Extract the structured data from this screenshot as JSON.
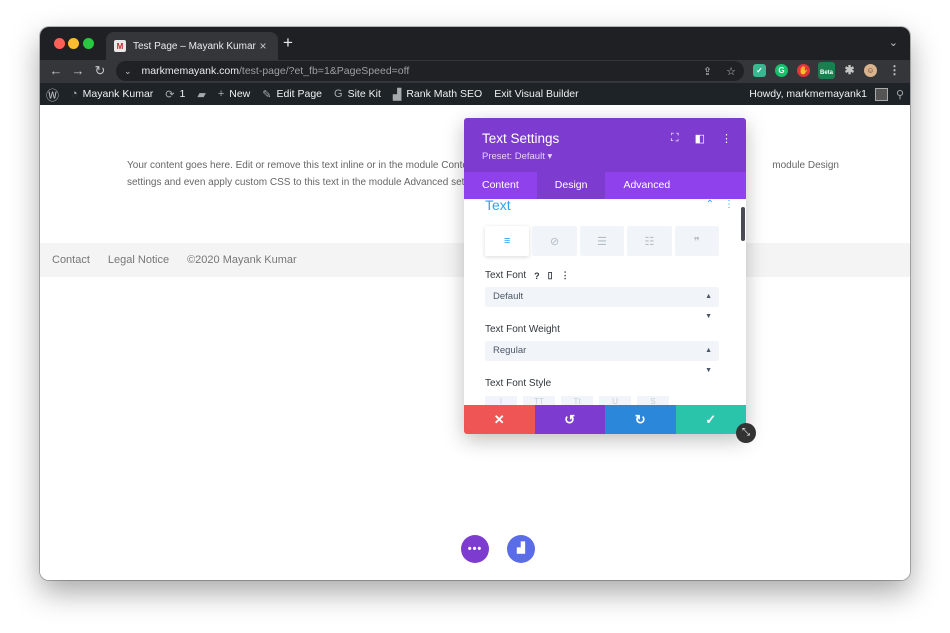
{
  "browser": {
    "tab_title": "Test Page – Mayank Kumar",
    "tab_close": "×",
    "new_tab": "+",
    "tab_menu": "⌄",
    "url_host": "markmemayank.com",
    "url_path": "/test-page/?et_fb=1&PageSpeed=off",
    "nav_back": "←",
    "nav_forward": "→",
    "nav_reload": "↻",
    "extension_beta_badge": "Beta"
  },
  "adminbar": {
    "site_name": "Mayank Kumar",
    "updates_count": "1",
    "new_label": "New",
    "edit_page_label": "Edit Page",
    "site_kit_label": "Site Kit",
    "rank_math_label": "Rank Math SEO",
    "exit_builder_label": "Exit Visual Builder",
    "howdy_label": "Howdy, markmemayank1"
  },
  "page": {
    "body_line1": "Your content goes here. Edit or remove this text inline or in the module Conte",
    "body_line1_right": "module Design",
    "body_line2": "settings and even apply custom CSS to this text in the module Advanced setti",
    "footer_contact": "Contact",
    "footer_legal": "Legal Notice",
    "footer_copyright": "©2020 Mayank Kumar"
  },
  "modal": {
    "title": "Text Settings",
    "preset": "Preset: Default ▾",
    "tabs": [
      "Content",
      "Design",
      "Advanced"
    ],
    "active_tab": "Design",
    "section_title": "Text",
    "text_font_label": "Text Font",
    "text_font_value": "Default",
    "text_font_weight_label": "Text Font Weight",
    "text_font_weight_value": "Regular",
    "text_font_style_label": "Text Font Style"
  },
  "colors": {
    "divi_purple": "#7e3bd0",
    "divi_purple_light": "#8f42ec",
    "divi_blue": "#2ea3f2",
    "cancel_red": "#ef5555",
    "redo_blue": "#2b87da",
    "save_green": "#29c4a9",
    "wp_admin_bar": "#1d2327"
  },
  "icons": {
    "footer": [
      "close-icon",
      "undo-icon",
      "redo-icon",
      "check-icon"
    ]
  }
}
